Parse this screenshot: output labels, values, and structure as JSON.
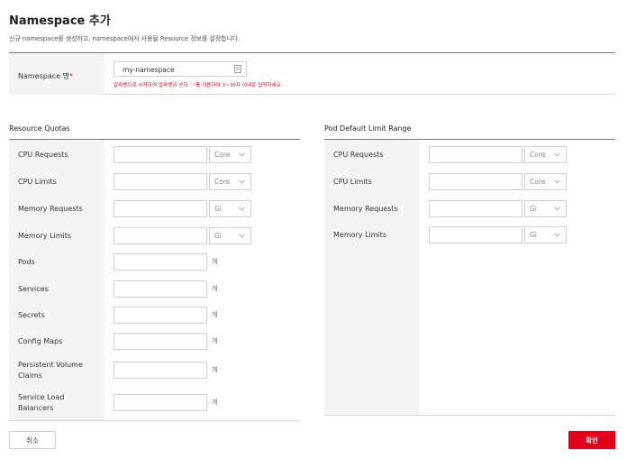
{
  "page": {
    "title": "Namespace 추가",
    "description": "신규 namespace를 생성하고, namespace에서 사용될 Resource 정보를 설정합니다."
  },
  "namespace": {
    "label": "Namespace 명",
    "required_mark": "*",
    "value": "my-namespace",
    "hint": "알파벳으로 시작하여 알파벳과 숫자, '-'를 이용하여 3~30자 이내로 입력하세요."
  },
  "resource_quotas": {
    "title": "Resource Quotas",
    "rows": [
      {
        "label": "CPU Requests",
        "unit": "Core"
      },
      {
        "label": "CPU Limits",
        "unit": "Core"
      },
      {
        "label": "Memory Requests",
        "unit": "Gi"
      },
      {
        "label": "Memory Limits",
        "unit": "Gi"
      },
      {
        "label": "Pods",
        "unit": "개"
      },
      {
        "label": "Services",
        "unit": "개"
      },
      {
        "label": "Secrets",
        "unit": "개"
      },
      {
        "label": "Config Maps",
        "unit": "개"
      },
      {
        "label": "Persistent Volume Claims",
        "unit": "개"
      },
      {
        "label": "Service Load Balancers",
        "unit": "개"
      }
    ]
  },
  "pod_limit_range": {
    "title": "Pod Default Limit Range",
    "rows": [
      {
        "label": "CPU Requests",
        "unit": "Core"
      },
      {
        "label": "CPU Limits",
        "unit": "Core"
      },
      {
        "label": "Memory Requests",
        "unit": "Gi"
      },
      {
        "label": "Memory Limits",
        "unit": "Gi"
      }
    ]
  },
  "buttons": {
    "cancel": "취소",
    "confirm": "확인"
  },
  "colors": {
    "accent": "#e2001b",
    "label_bg": "#f4f4f4"
  }
}
